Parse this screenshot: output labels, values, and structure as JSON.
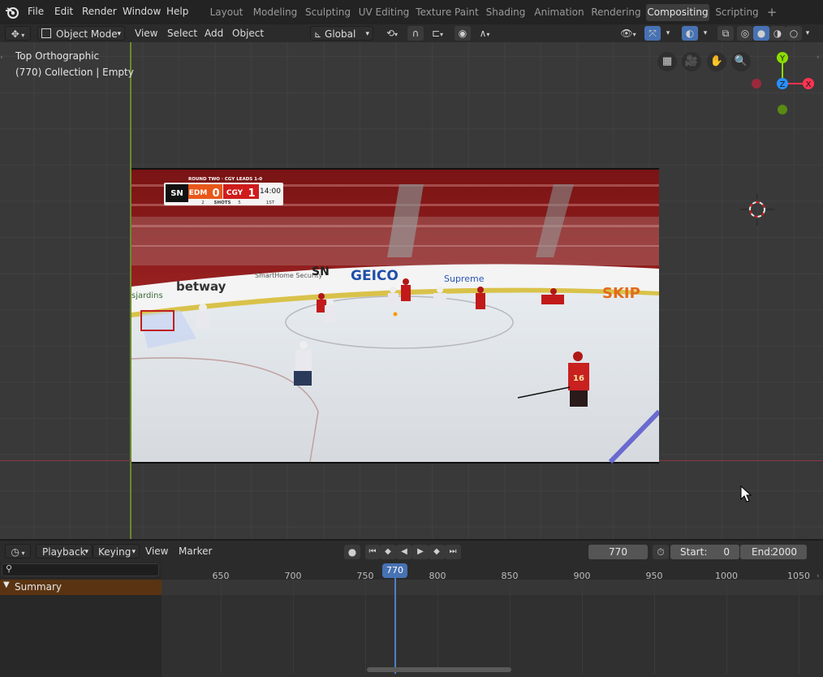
{
  "menubar": {
    "items": [
      "File",
      "Edit",
      "Render",
      "Window",
      "Help"
    ],
    "workspaces": [
      "Layout",
      "Modeling",
      "Sculpting",
      "UV Editing",
      "Texture Paint",
      "Shading",
      "Animation",
      "Rendering",
      "Compositing",
      "Scripting"
    ],
    "active_workspace": "Compositing",
    "add_tab": "+"
  },
  "view_header": {
    "mode": "Object Mode",
    "menus": [
      "View",
      "Select",
      "Add",
      "Object"
    ],
    "orientation": "Global"
  },
  "viewport": {
    "view_name": "Top Orthographic",
    "collection_info": "(770) Collection | Empty",
    "gizmo": {
      "y": "Y",
      "x": "X",
      "z": "Z"
    },
    "broadcast_image": {
      "network": "SN",
      "series_note": "ROUND TWO · CGY LEADS 1-0",
      "team1": "EDM",
      "score1": "0",
      "team2": "CGY",
      "score2": "1",
      "clock": "14:00",
      "period": "1ST",
      "shots_label": "SHOTS",
      "shots1": "2",
      "shots2": "5",
      "ads": [
        "betway",
        "SmartHome Security",
        "SN",
        "GEICO",
        "Supreme",
        "SKIP",
        "sjardins"
      ],
      "player_number": "16"
    }
  },
  "timeline_header": {
    "menus": [
      "Playback",
      "Keying",
      "View",
      "Marker"
    ],
    "current_frame": "770",
    "start_label": "Start:",
    "start_value": "0",
    "end_label": "End:",
    "end_value": "2000"
  },
  "timeline": {
    "summary_label": "Summary",
    "current_frame_label": "770",
    "ticks": [
      "650",
      "700",
      "750",
      "800",
      "850",
      "900",
      "950",
      "1000",
      "1050"
    ]
  },
  "colors": {
    "accent_blue": "#4772b3",
    "summary_orange": "#5a3412",
    "x_axis": "#ff3352",
    "y_axis": "#8bdc00",
    "z_axis": "#2890ff"
  }
}
